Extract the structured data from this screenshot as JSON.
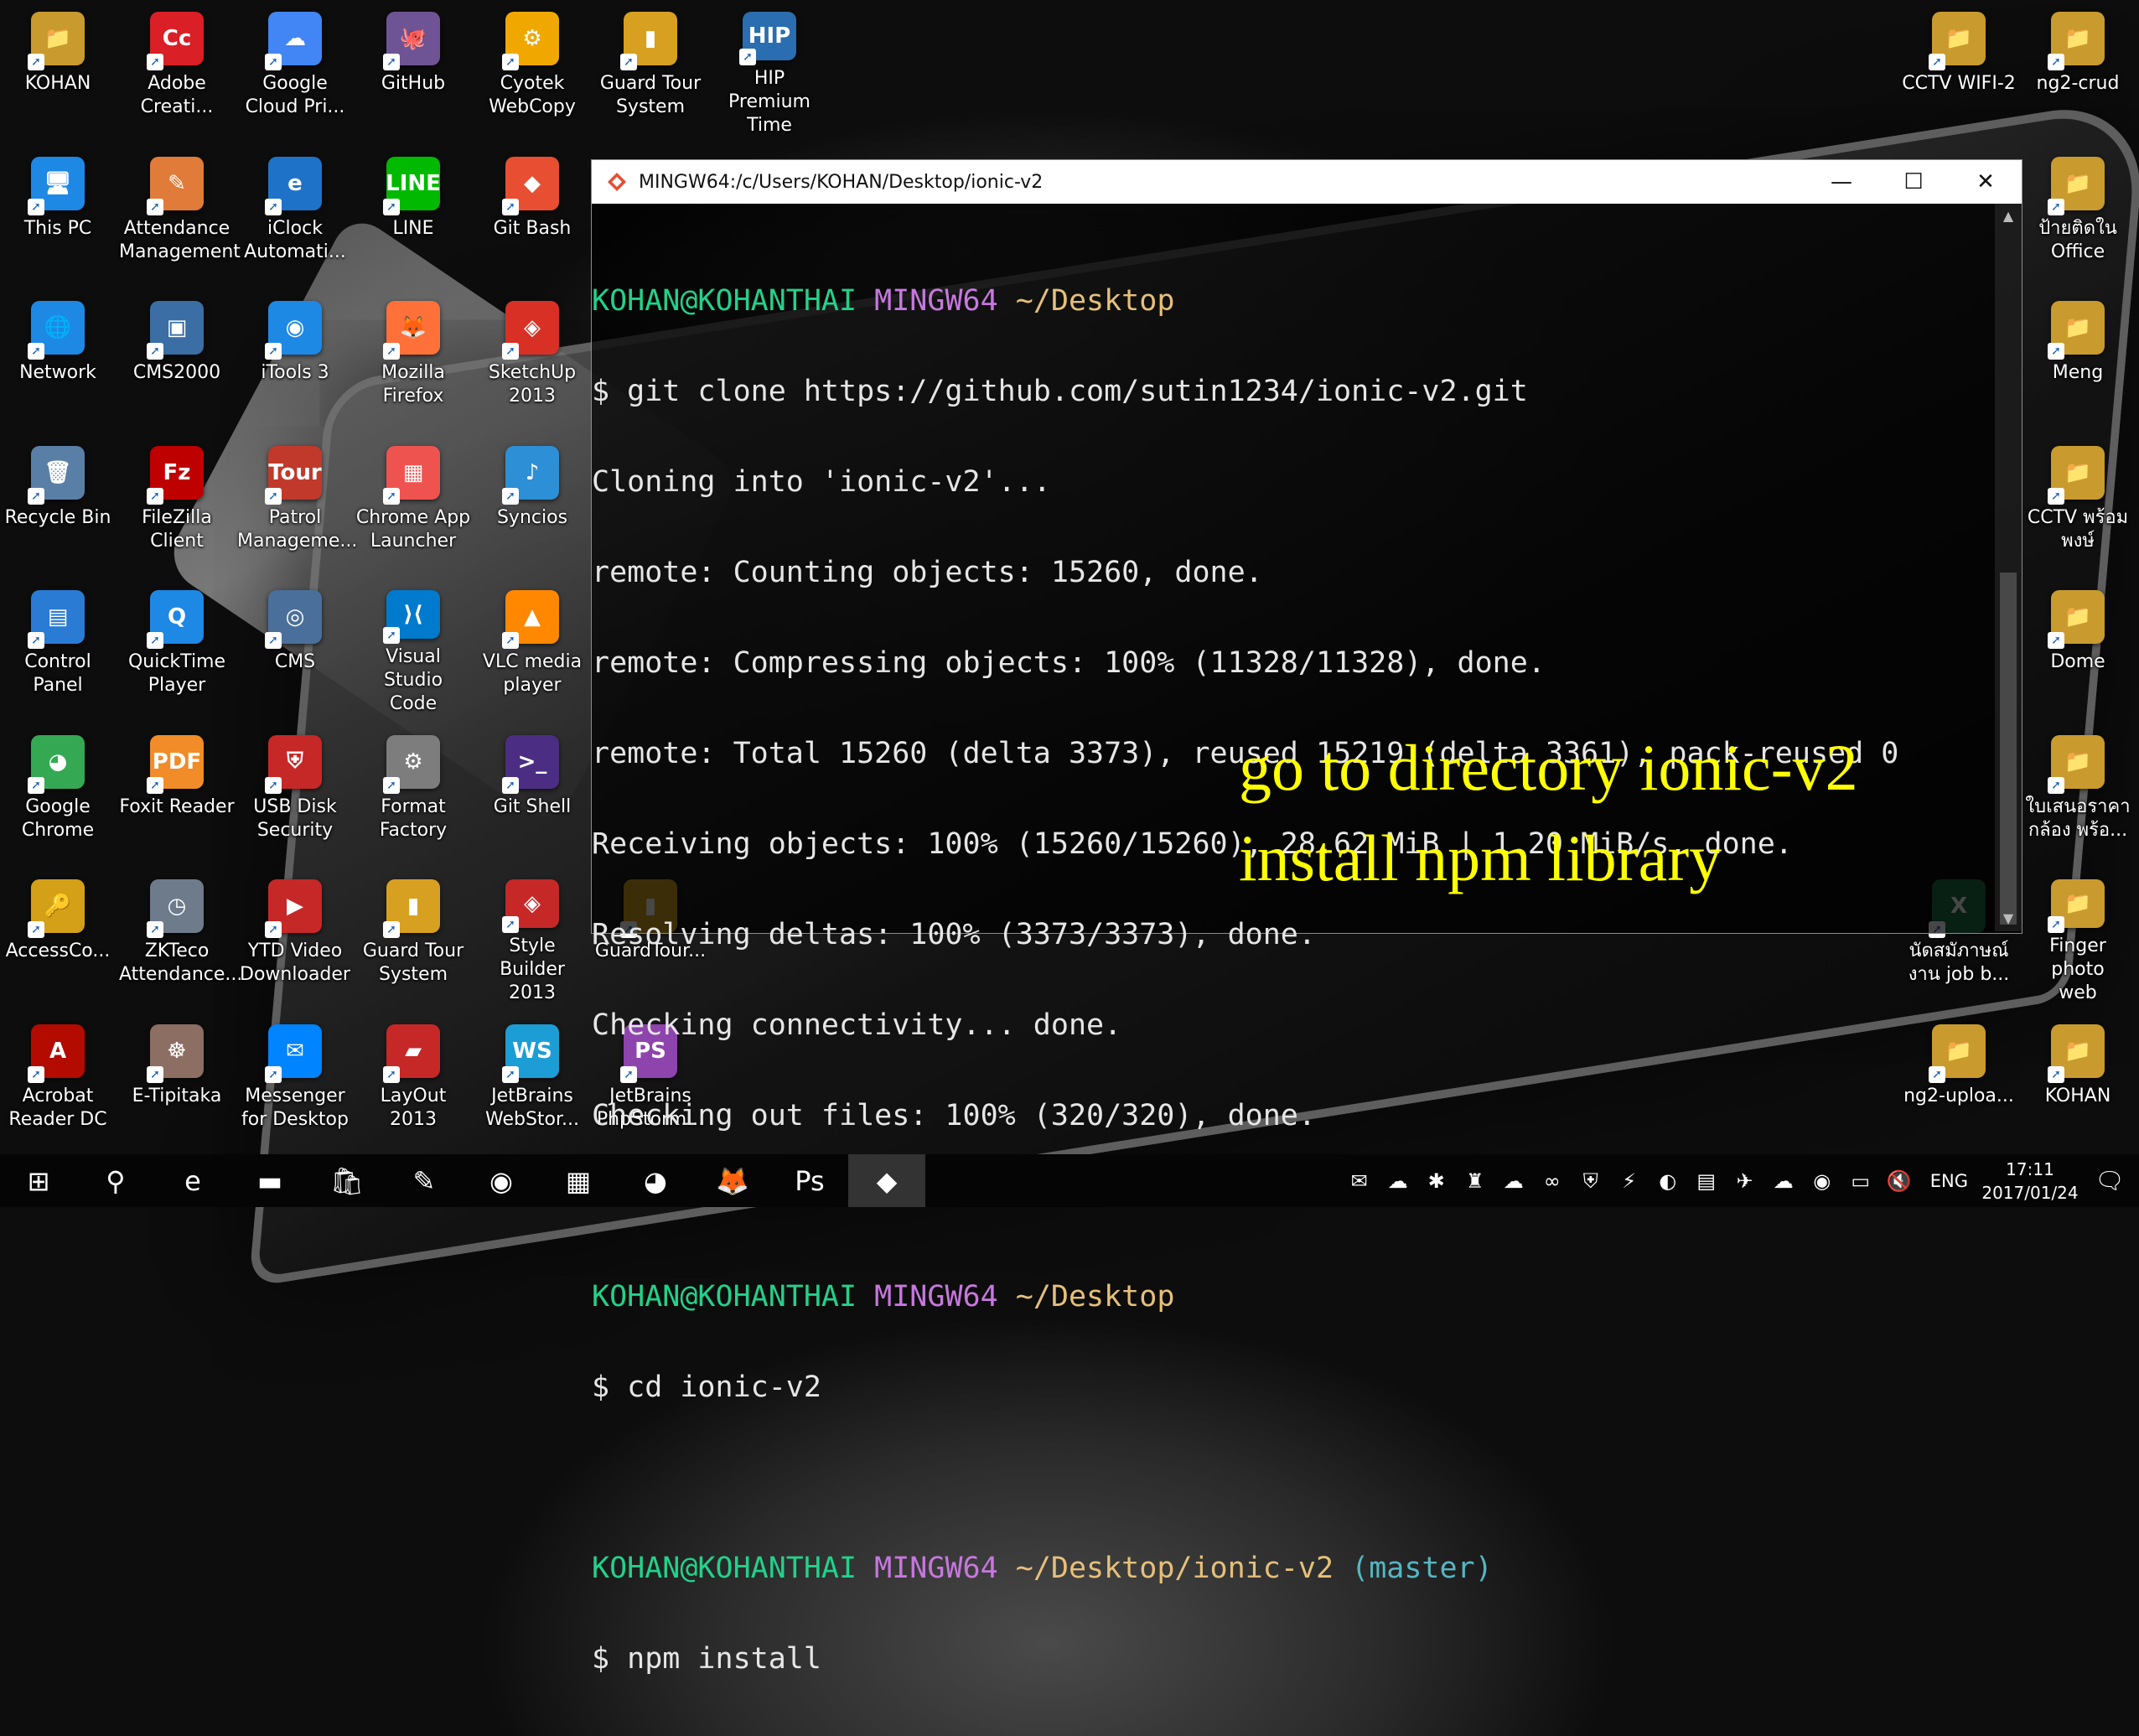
{
  "desktop": {
    "icons": [
      {
        "label": "KOHAN",
        "glyph": "📁",
        "color": "#c99a2e"
      },
      {
        "label": "Adobe\nCreati...",
        "glyph": "Cc",
        "color": "#da1f26"
      },
      {
        "label": "Google\nCloud Pri...",
        "glyph": "☁",
        "color": "#4285f4"
      },
      {
        "label": "GitHub",
        "glyph": "🐙",
        "color": "#6e5494"
      },
      {
        "label": "Cyotek\nWebCopy",
        "glyph": "⚙",
        "color": "#f0a800"
      },
      {
        "label": "Guard Tour\nSystem",
        "glyph": "▮",
        "color": "#d8a020"
      },
      {
        "label": "HIP Premium\nTime",
        "glyph": "HIP",
        "color": "#2a6db0"
      },
      {
        "label": "This PC",
        "glyph": "🖥",
        "color": "#1e88e5"
      },
      {
        "label": "Attendance\nManagement",
        "glyph": "✎",
        "color": "#e07b39"
      },
      {
        "label": "iClock\nAutomati...",
        "glyph": "e",
        "color": "#1e73c8"
      },
      {
        "label": "LINE",
        "glyph": "LINE",
        "color": "#00b900"
      },
      {
        "label": "Git Bash",
        "glyph": "◆",
        "color": "#e84e31"
      },
      {
        "label": "Network",
        "glyph": "🌐",
        "color": "#1e88e5"
      },
      {
        "label": "CMS2000",
        "glyph": "▣",
        "color": "#3a6ea5"
      },
      {
        "label": "iTools 3",
        "glyph": "◉",
        "color": "#1e88e5"
      },
      {
        "label": "Mozilla\nFirefox",
        "glyph": "🦊",
        "color": "#ff7139"
      },
      {
        "label": "SketchUp\n2013",
        "glyph": "◈",
        "color": "#d93025"
      },
      {
        "label": "Recycle Bin",
        "glyph": "🗑",
        "color": "#5a7fa6"
      },
      {
        "label": "FileZilla\nClient",
        "glyph": "Fz",
        "color": "#bf0000"
      },
      {
        "label": "Patrol\nManageme...",
        "glyph": "Tour",
        "color": "#c0392b"
      },
      {
        "label": "Chrome App\nLauncher",
        "glyph": "▦",
        "color": "#ef5350"
      },
      {
        "label": "Syncios",
        "glyph": "♪",
        "color": "#2d8fd5"
      },
      {
        "label": "Control\nPanel",
        "glyph": "▤",
        "color": "#2a7bd4"
      },
      {
        "label": "QuickTime\nPlayer",
        "glyph": "Q",
        "color": "#1e88e5"
      },
      {
        "label": "CMS",
        "glyph": "◎",
        "color": "#4a6f9a"
      },
      {
        "label": "Visual Studio\nCode",
        "glyph": "⟩⟨",
        "color": "#007acc"
      },
      {
        "label": "VLC media\nplayer",
        "glyph": "▲",
        "color": "#ff8800"
      },
      {
        "label": "Google\nChrome",
        "glyph": "◕",
        "color": "#34a853"
      },
      {
        "label": "Foxit Reader",
        "glyph": "PDF",
        "color": "#f28c28"
      },
      {
        "label": "USB Disk\nSecurity",
        "glyph": "⛨",
        "color": "#c62828"
      },
      {
        "label": "Format\nFactory",
        "glyph": "⚙",
        "color": "#7d7d7d"
      },
      {
        "label": "Git Shell",
        "glyph": ">_",
        "color": "#4b2e83"
      },
      {
        "label": "AccessCo...",
        "glyph": "🔑",
        "color": "#d4a017"
      },
      {
        "label": "ZKTeco\nAttendance...",
        "glyph": "◷",
        "color": "#6e7b8b"
      },
      {
        "label": "YTD Video\nDownloader",
        "glyph": "▶",
        "color": "#c62828"
      },
      {
        "label": "Guard Tour\nSystem",
        "glyph": "▮",
        "color": "#d8a020"
      },
      {
        "label": "Style Builder\n2013",
        "glyph": "◈",
        "color": "#c62828"
      },
      {
        "label": "GuardTour...",
        "glyph": "▮",
        "color": "#d8a020"
      },
      {
        "label": "Acrobat\nReader DC",
        "glyph": "A",
        "color": "#b30b00"
      },
      {
        "label": "E-Tipitaka",
        "glyph": "☸",
        "color": "#8d6e63"
      },
      {
        "label": "Messenger\nfor Desktop",
        "glyph": "✉",
        "color": "#0084ff"
      },
      {
        "label": "LayOut 2013",
        "glyph": "▰",
        "color": "#c62828"
      },
      {
        "label": "JetBrains\nWebStor...",
        "glyph": "WS",
        "color": "#1c9dd6"
      },
      {
        "label": "JetBrains\nPhpStorm...",
        "glyph": "PS",
        "color": "#8e44ad"
      },
      {
        "label": "CCTV WIFI-2",
        "glyph": "📁",
        "color": "#c99a2e"
      },
      {
        "label": "ng2-crud",
        "glyph": "📁",
        "color": "#c99a2e"
      },
      {
        "label": "ป้ายติดใน\nOffice",
        "glyph": "📁",
        "color": "#c99a2e"
      },
      {
        "label": "Meng",
        "glyph": "📁",
        "color": "#c99a2e"
      },
      {
        "label": "CCTV พร้อม\nพงษ์",
        "glyph": "📁",
        "color": "#c99a2e"
      },
      {
        "label": "Dome",
        "glyph": "📁",
        "color": "#c99a2e"
      },
      {
        "label": "ใบเสนอราคา\nกล้อง พร้อ...",
        "glyph": "📁",
        "color": "#c99a2e"
      },
      {
        "label": "นัดสมัภาษณ์\nงาน job b...",
        "glyph": "X",
        "color": "#1e7145"
      },
      {
        "label": "Finger photo\nweb",
        "glyph": "📁",
        "color": "#c99a2e"
      },
      {
        "label": "ng2-uploa...",
        "glyph": "📁",
        "color": "#c99a2e"
      },
      {
        "label": "KOHAN",
        "glyph": "📁",
        "color": "#c99a2e"
      }
    ]
  },
  "terminal": {
    "title": "MINGW64:/c/Users/KOHAN/Desktop/ionic-v2",
    "buttons": {
      "minimize": "—",
      "maximize": "☐",
      "close": "✕"
    },
    "prompt_user": "KOHAN@KOHANTHAI",
    "prompt_env": "MINGW64",
    "path1": "~/Desktop",
    "path2": "~/Desktop/ionic-v2",
    "branch": "(master)",
    "cmd1": "$ git clone https://github.com/sutin1234/ionic-v2.git",
    "out": [
      "Cloning into 'ionic-v2'...",
      "remote: Counting objects: 15260, done.",
      "remote: Compressing objects: 100% (11328/11328), done.",
      "remote: Total 15260 (delta 3373), reused 15219 (delta 3361), pack-reused 0",
      "Receiving objects: 100% (15260/15260), 28.62 MiB | 1.20 MiB/s, done.",
      "Resolving deltas: 100% (3373/3373), done.",
      "Checking connectivity... done.",
      "Checking out files: 100% (320/320), done."
    ],
    "cmd2": "$ cd ionic-v2",
    "cmd3": "$ npm install",
    "colors": {
      "user": "#23d18b",
      "env": "#c678dd",
      "path": "#e5c07b",
      "branch": "#56b6c2"
    }
  },
  "annotation": {
    "line1": "go to directory ionic-v2",
    "line2": "install npm library",
    "color": "#ffff00"
  },
  "taskbar": {
    "items": [
      {
        "name": "start-button",
        "glyph": "⊞"
      },
      {
        "name": "search-button",
        "glyph": "⚲"
      },
      {
        "name": "edge-button",
        "glyph": "e"
      },
      {
        "name": "file-explorer-button",
        "glyph": "▬"
      },
      {
        "name": "store-button",
        "glyph": "🛍"
      },
      {
        "name": "app-button-1",
        "glyph": "✎"
      },
      {
        "name": "itools-button",
        "glyph": "◉"
      },
      {
        "name": "apps-button",
        "glyph": "▦"
      },
      {
        "name": "chrome-button",
        "glyph": "◕"
      },
      {
        "name": "firefox-button",
        "glyph": "🦊"
      },
      {
        "name": "photoshop-button",
        "glyph": "Ps"
      },
      {
        "name": "git-bash-button",
        "glyph": "◆"
      }
    ],
    "tray_icons": [
      "✉",
      "☁",
      "✱",
      "♜",
      "☁",
      "∞",
      "⛨",
      "⚡",
      "◐",
      "▤",
      "✈",
      "☁",
      "◉",
      "▭",
      "🔇"
    ],
    "language": "ENG",
    "time": "17:11",
    "date": "2017/01/24",
    "notification": "🗨"
  }
}
